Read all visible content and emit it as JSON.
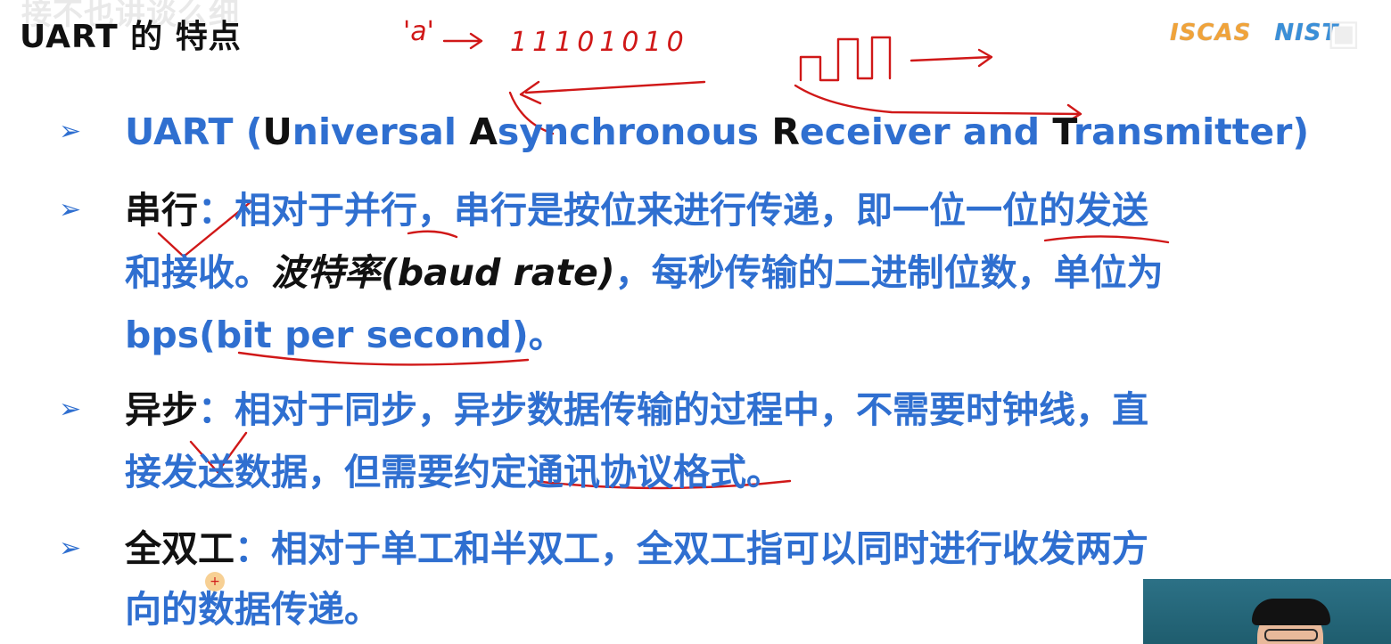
{
  "caption": "接不也讲谈么细",
  "title": "UART 的 特点",
  "logos": {
    "left": "ISCAS",
    "right": "NIST"
  },
  "annotations": {
    "bits": "11101010",
    "char": "'a'"
  },
  "bullet_symbol": "➢",
  "bullets": [
    {
      "lines": [
        {
          "segments": [
            {
              "text": "UART (",
              "style": "blue"
            },
            {
              "text": "U",
              "style": "acc"
            },
            {
              "text": "niversal ",
              "style": "blue"
            },
            {
              "text": "A",
              "style": "acc"
            },
            {
              "text": "synchronous ",
              "style": "blue"
            },
            {
              "text": "R",
              "style": "acc"
            },
            {
              "text": "eceiver and ",
              "style": "blue"
            },
            {
              "text": "T",
              "style": "acc"
            },
            {
              "text": "ransmitter)",
              "style": "blue"
            }
          ]
        }
      ]
    },
    {
      "lines": [
        {
          "segments": [
            {
              "text": "串行",
              "style": "kw"
            },
            {
              "text": "：相对于并行，串行是按位来进行传递，即一位一位的发送",
              "style": "blue"
            }
          ]
        },
        {
          "segments": [
            {
              "text": "和接收。",
              "style": "blue"
            },
            {
              "text": "波特率(baud rate)",
              "style": "it"
            },
            {
              "text": "，每秒传输的二进制位数，单位为",
              "style": "blue"
            }
          ]
        },
        {
          "segments": [
            {
              "text": "bps(bit per second)。",
              "style": "blue"
            }
          ]
        }
      ]
    },
    {
      "lines": [
        {
          "segments": [
            {
              "text": "异步",
              "style": "kw"
            },
            {
              "text": "：相对于同步，异步数据传输的过程中，不需要时钟线，直",
              "style": "blue"
            }
          ]
        },
        {
          "segments": [
            {
              "text": "接发送数据，但需要约定通讯协议格式。",
              "style": "blue"
            }
          ]
        }
      ]
    },
    {
      "lines": [
        {
          "segments": [
            {
              "text": "全双工",
              "style": "kw"
            },
            {
              "text": "：相对于单工和半双工，全双工指可以同时进行收发两方",
              "style": "blue"
            }
          ]
        },
        {
          "segments": [
            {
              "text": "向的数据传递。",
              "style": "blue"
            }
          ]
        }
      ]
    }
  ],
  "colors": {
    "text_blue": "#2f6fd0",
    "ink_red": "#d01818",
    "keyword": "#111111"
  }
}
